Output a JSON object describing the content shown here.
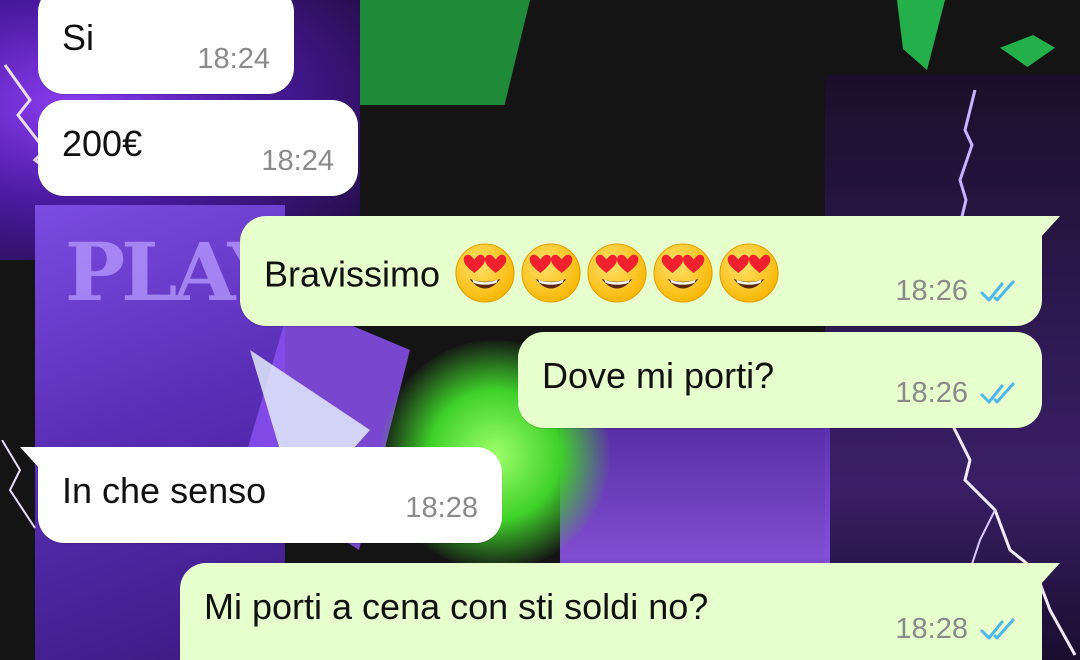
{
  "colors": {
    "incoming_bubble": "#ffffff",
    "outgoing_bubble": "#e7fecd",
    "read_ticks": "#4fb6ec",
    "timestamp": "#8a8a8a"
  },
  "messages": [
    {
      "direction": "incoming",
      "text": "Si",
      "time": "18:24"
    },
    {
      "direction": "incoming",
      "text": "200€",
      "time": "18:24"
    },
    {
      "direction": "outgoing",
      "text": "Bravissimo",
      "emoji": [
        "heart-eyes-emoji",
        "heart-eyes-emoji",
        "heart-eyes-emoji",
        "heart-eyes-emoji",
        "heart-eyes-emoji"
      ],
      "time": "18:26",
      "status": "read-double-check-icon"
    },
    {
      "direction": "outgoing",
      "text": "Dove mi porti?",
      "time": "18:26",
      "status": "read-double-check-icon"
    },
    {
      "direction": "incoming",
      "text": "In che senso",
      "time": "18:28"
    },
    {
      "direction": "outgoing",
      "text": "Mi porti a cena con sti soldi no?",
      "time": "18:28",
      "status": "read-double-check-icon"
    }
  ],
  "wallpaper": {
    "sign_text": "PLAY"
  }
}
